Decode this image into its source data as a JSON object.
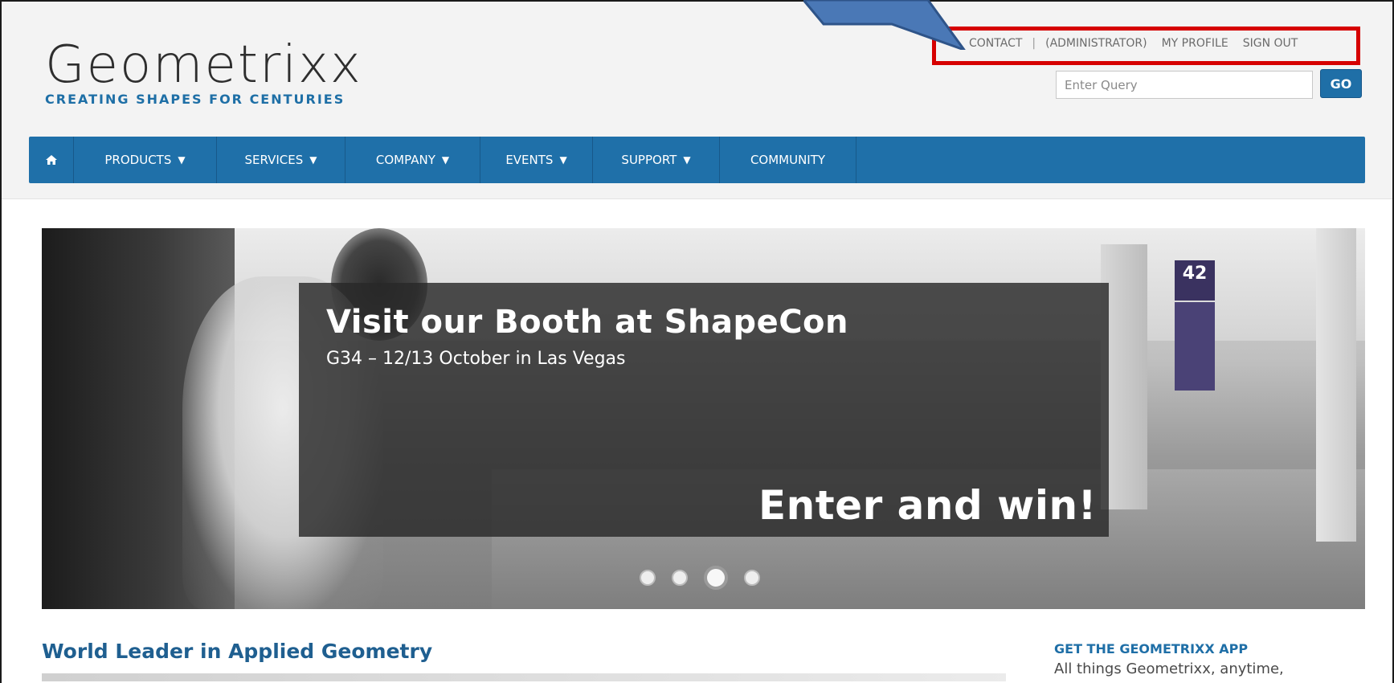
{
  "brand": {
    "logo": "Geometrixx",
    "tagline": "CREATING SHAPES FOR CENTURIES"
  },
  "utility": {
    "contact": "CONTACT",
    "separator": "|",
    "user": "(ADMINISTRATOR)",
    "my_profile": "MY PROFILE",
    "sign_out": "SIGN OUT"
  },
  "search": {
    "placeholder": "Enter Query",
    "button": "GO"
  },
  "nav": {
    "home_icon": "home-icon",
    "items": [
      {
        "label": "PRODUCTS",
        "dropdown": true
      },
      {
        "label": "SERVICES",
        "dropdown": true
      },
      {
        "label": "COMPANY",
        "dropdown": true
      },
      {
        "label": "EVENTS",
        "dropdown": true
      },
      {
        "label": "SUPPORT",
        "dropdown": true
      },
      {
        "label": "COMMUNITY",
        "dropdown": false
      }
    ],
    "caret": "▼"
  },
  "hero": {
    "title": "Visit our Booth at ShapeCon",
    "subtitle": "G34 – 12/13 October in Las Vegas",
    "cta": "Enter and win!",
    "sign_number": "42",
    "slides_total": 4,
    "active_slide": 3
  },
  "main": {
    "heading": "World Leader in Applied Geometry"
  },
  "sidebar": {
    "app_heading": "GET THE GEOMETRIXX APP",
    "app_text": "All things Geometrixx, anytime,"
  },
  "colors": {
    "brand_blue": "#1f70a9",
    "heading_blue": "#1f5f90",
    "highlight_red": "#d60000",
    "arrow_blue": "#4a78b6"
  }
}
